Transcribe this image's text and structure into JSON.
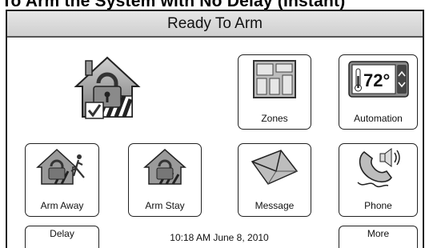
{
  "doc_title": "To Arm the System with No Delay (Instant)",
  "status": {
    "text": "Ready To Arm"
  },
  "tiles": {
    "zones": {
      "label": "Zones",
      "icon": "zones-grid-icon"
    },
    "automation": {
      "label": "Automation",
      "icon": "thermostat-icon",
      "temperature": "72°"
    },
    "arm_away": {
      "label": "Arm Away",
      "icon": "house-lock-runner-icon"
    },
    "arm_stay": {
      "label": "Arm Stay",
      "icon": "house-lock-icon"
    },
    "message": {
      "label": "Message",
      "icon": "envelope-icon"
    },
    "phone": {
      "label": "Phone",
      "icon": "phone-speaker-icon"
    }
  },
  "main_status_icon": "house-lock-checkmark-icon",
  "bottom": {
    "delay_label": "Delay",
    "datetime": "10:18 AM June 8, 2010",
    "more_label": "More"
  }
}
